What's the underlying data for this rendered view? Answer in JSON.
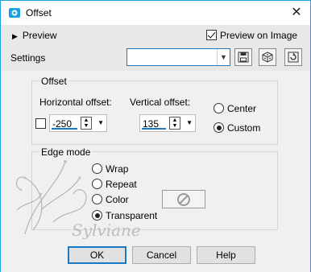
{
  "window": {
    "title": "Offset",
    "close_glyph": "✕"
  },
  "preview": {
    "toggle_label": "Preview",
    "preview_on_image_label": "Preview on Image",
    "preview_on_image_checked": true
  },
  "settings": {
    "label": "Settings",
    "value": ""
  },
  "offset_group": {
    "title": "Offset",
    "horizontal_label": "Horizontal offset:",
    "horizontal_value": "-250",
    "vertical_label": "Vertical offset:",
    "vertical_value": "135",
    "center_label": "Center",
    "custom_label": "Custom",
    "selected": "Custom"
  },
  "edge_mode": {
    "title": "Edge mode",
    "wrap_label": "Wrap",
    "repeat_label": "Repeat",
    "color_label": "Color",
    "transparent_label": "Transparent",
    "selected": "Transparent"
  },
  "watermark": {
    "text": "Sylviane"
  },
  "buttons": {
    "ok": "OK",
    "cancel": "Cancel",
    "help": "Help"
  },
  "colors": {
    "accent": "#1b78c2",
    "window_border": "#1ba1e2"
  }
}
